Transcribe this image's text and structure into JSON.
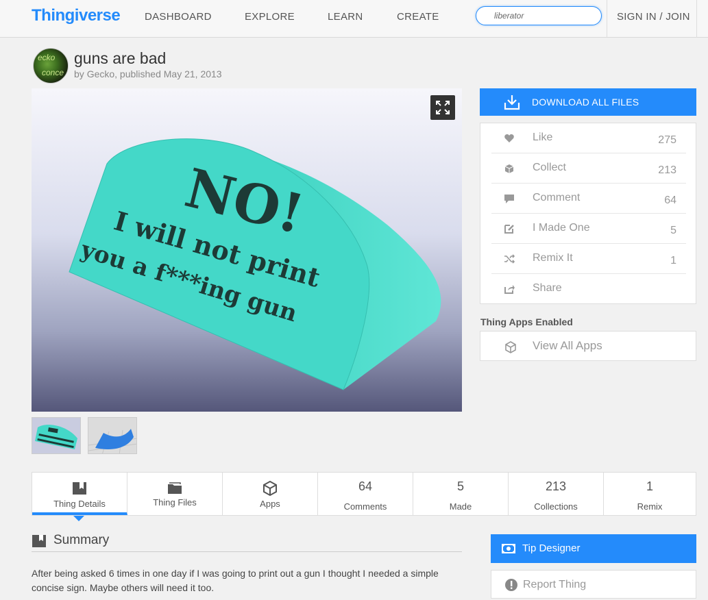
{
  "header": {
    "logo": "Thingiverse",
    "nav": [
      "DASHBOARD",
      "EXPLORE",
      "LEARN",
      "CREATE"
    ],
    "search_value": "liberator",
    "signin": "SIGN IN / JOIN"
  },
  "thing": {
    "title": "guns are bad",
    "byline_prefix": "by ",
    "author": "Gecko",
    "published": ", published May 21, 2013",
    "avatar_text_1": "ecko",
    "avatar_text_2": "conce",
    "sign_line_1": "NO!",
    "sign_line_2": "I will not print",
    "sign_line_3": "you a f***ing gun"
  },
  "sidebar": {
    "download_label": "DOWNLOAD ALL FILES",
    "actions": [
      {
        "label": "Like",
        "count": "275"
      },
      {
        "label": "Collect",
        "count": "213"
      },
      {
        "label": "Comment",
        "count": "64"
      },
      {
        "label": "I Made One",
        "count": "5"
      },
      {
        "label": "Remix It",
        "count": "1"
      },
      {
        "label": "Share",
        "count": ""
      }
    ],
    "apps_heading": "Thing Apps Enabled",
    "apps_label": "View All Apps"
  },
  "tabs": [
    {
      "label": "Thing Details",
      "num": ""
    },
    {
      "label": "Thing Files",
      "num": ""
    },
    {
      "label": "Apps",
      "num": ""
    },
    {
      "label": "Comments",
      "num": "64"
    },
    {
      "label": "Made",
      "num": "5"
    },
    {
      "label": "Collections",
      "num": "213"
    },
    {
      "label": "Remix",
      "num": "1"
    }
  ],
  "summary": {
    "title": "Summary",
    "text": "After being asked 6 times in one day if I was going to print out a gun I thought I needed a simple concise sign. Maybe others will need it too."
  },
  "right_buttons": {
    "tip": "Tip Designer",
    "report": "Report Thing"
  },
  "colors": {
    "accent": "#248bfb",
    "model": "#3fd6c6"
  }
}
